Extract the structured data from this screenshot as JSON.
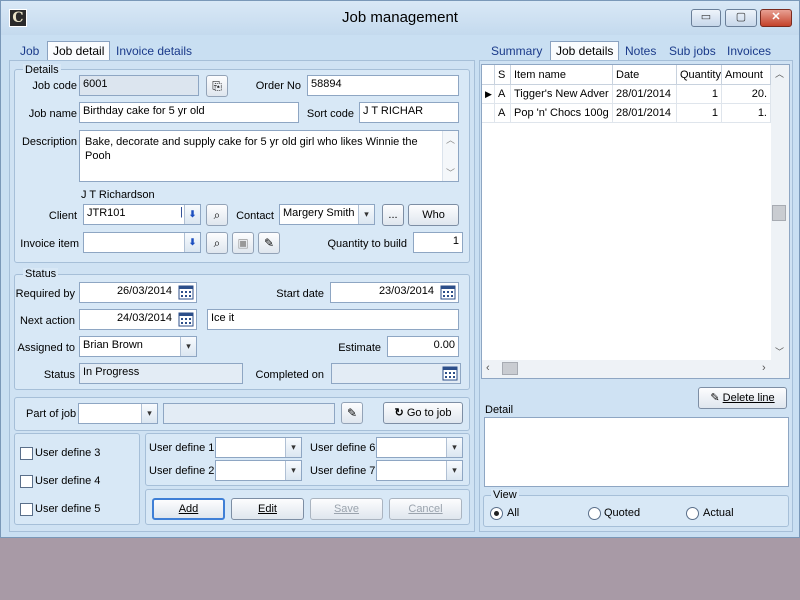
{
  "window": {
    "title": "Job management",
    "app_icon": "C",
    "minimize": "▭",
    "maximize": "▢",
    "close": "✕"
  },
  "left_tabs": [
    {
      "label": "Job"
    },
    {
      "label": "Job detail"
    },
    {
      "label": "Invoice details"
    }
  ],
  "right_tabs": [
    {
      "label": "Summary"
    },
    {
      "label": "Job details"
    },
    {
      "label": "Notes"
    },
    {
      "label": "Sub jobs"
    },
    {
      "label": "Invoices"
    }
  ],
  "details": {
    "legend": "Details",
    "job_code_label": "Job code",
    "job_code": "6001",
    "order_no_label": "Order No",
    "order_no": "58894",
    "job_name_label": "Job name",
    "job_name": "Birthday cake for 5 yr old",
    "sort_code_label": "Sort code",
    "sort_code": "J T RICHAR",
    "description_label": "Description",
    "description": "Bake, decorate and supply cake for 5 yr old girl who likes Winnie the Pooh",
    "client_name": "J T Richardson",
    "client_label": "Client",
    "client": "JTR101",
    "contact_label": "Contact",
    "contact": "Margery Smith",
    "ellipsis_label": "...",
    "who_label": "Who",
    "invoice_item_label": "Invoice item",
    "invoice_item": "",
    "qty_label": "Quantity to build",
    "qty": "1"
  },
  "status": {
    "legend": "Status",
    "required_by_label": "Required by",
    "required_by": "26/03/2014",
    "start_date_label": "Start date",
    "start_date": "23/03/2014",
    "next_action_label": "Next action",
    "next_action": "24/03/2014",
    "next_action_text": "Ice it",
    "assigned_to_label": "Assigned to",
    "assigned_to": "Brian Brown",
    "estimate_label": "Estimate",
    "estimate": "0.00",
    "status_label": "Status",
    "status": "In Progress",
    "completed_on_label": "Completed on",
    "completed_on": ""
  },
  "part_of_job": {
    "label": "Part of job",
    "value": "",
    "text": "",
    "go_label": "Go to job"
  },
  "user_defines": {
    "checks": [
      "User define 3",
      "User define 4",
      "User define 5"
    ],
    "ud1": "User define 1",
    "ud2": "User define 2",
    "ud6": "User define 6",
    "ud7": "User define 7"
  },
  "actions": {
    "add": "Add",
    "edit": "Edit",
    "save": "Save",
    "cancel": "Cancel"
  },
  "grid": {
    "headers": [
      "S",
      "Item name",
      "Date",
      "Quantity",
      "Amount"
    ],
    "rows": [
      {
        "s": "A",
        "name": "Tigger's New Adver",
        "date": "28/01/2014",
        "qty": "1",
        "amount": "20."
      },
      {
        "s": "A",
        "name": "Pop 'n' Chocs 100g",
        "date": "28/01/2014",
        "qty": "1",
        "amount": "1."
      }
    ]
  },
  "delete_line": "Delete line",
  "detail_label": "Detail",
  "view": {
    "legend": "View",
    "options": [
      "All",
      "Quoted",
      "Actual"
    ],
    "selected": "All"
  },
  "colors": {
    "window_bg": "#c9dff2",
    "panel_bg": "#d8e8f6",
    "desktop": "#a89aa6",
    "tab_link": "#1a3a8a"
  }
}
